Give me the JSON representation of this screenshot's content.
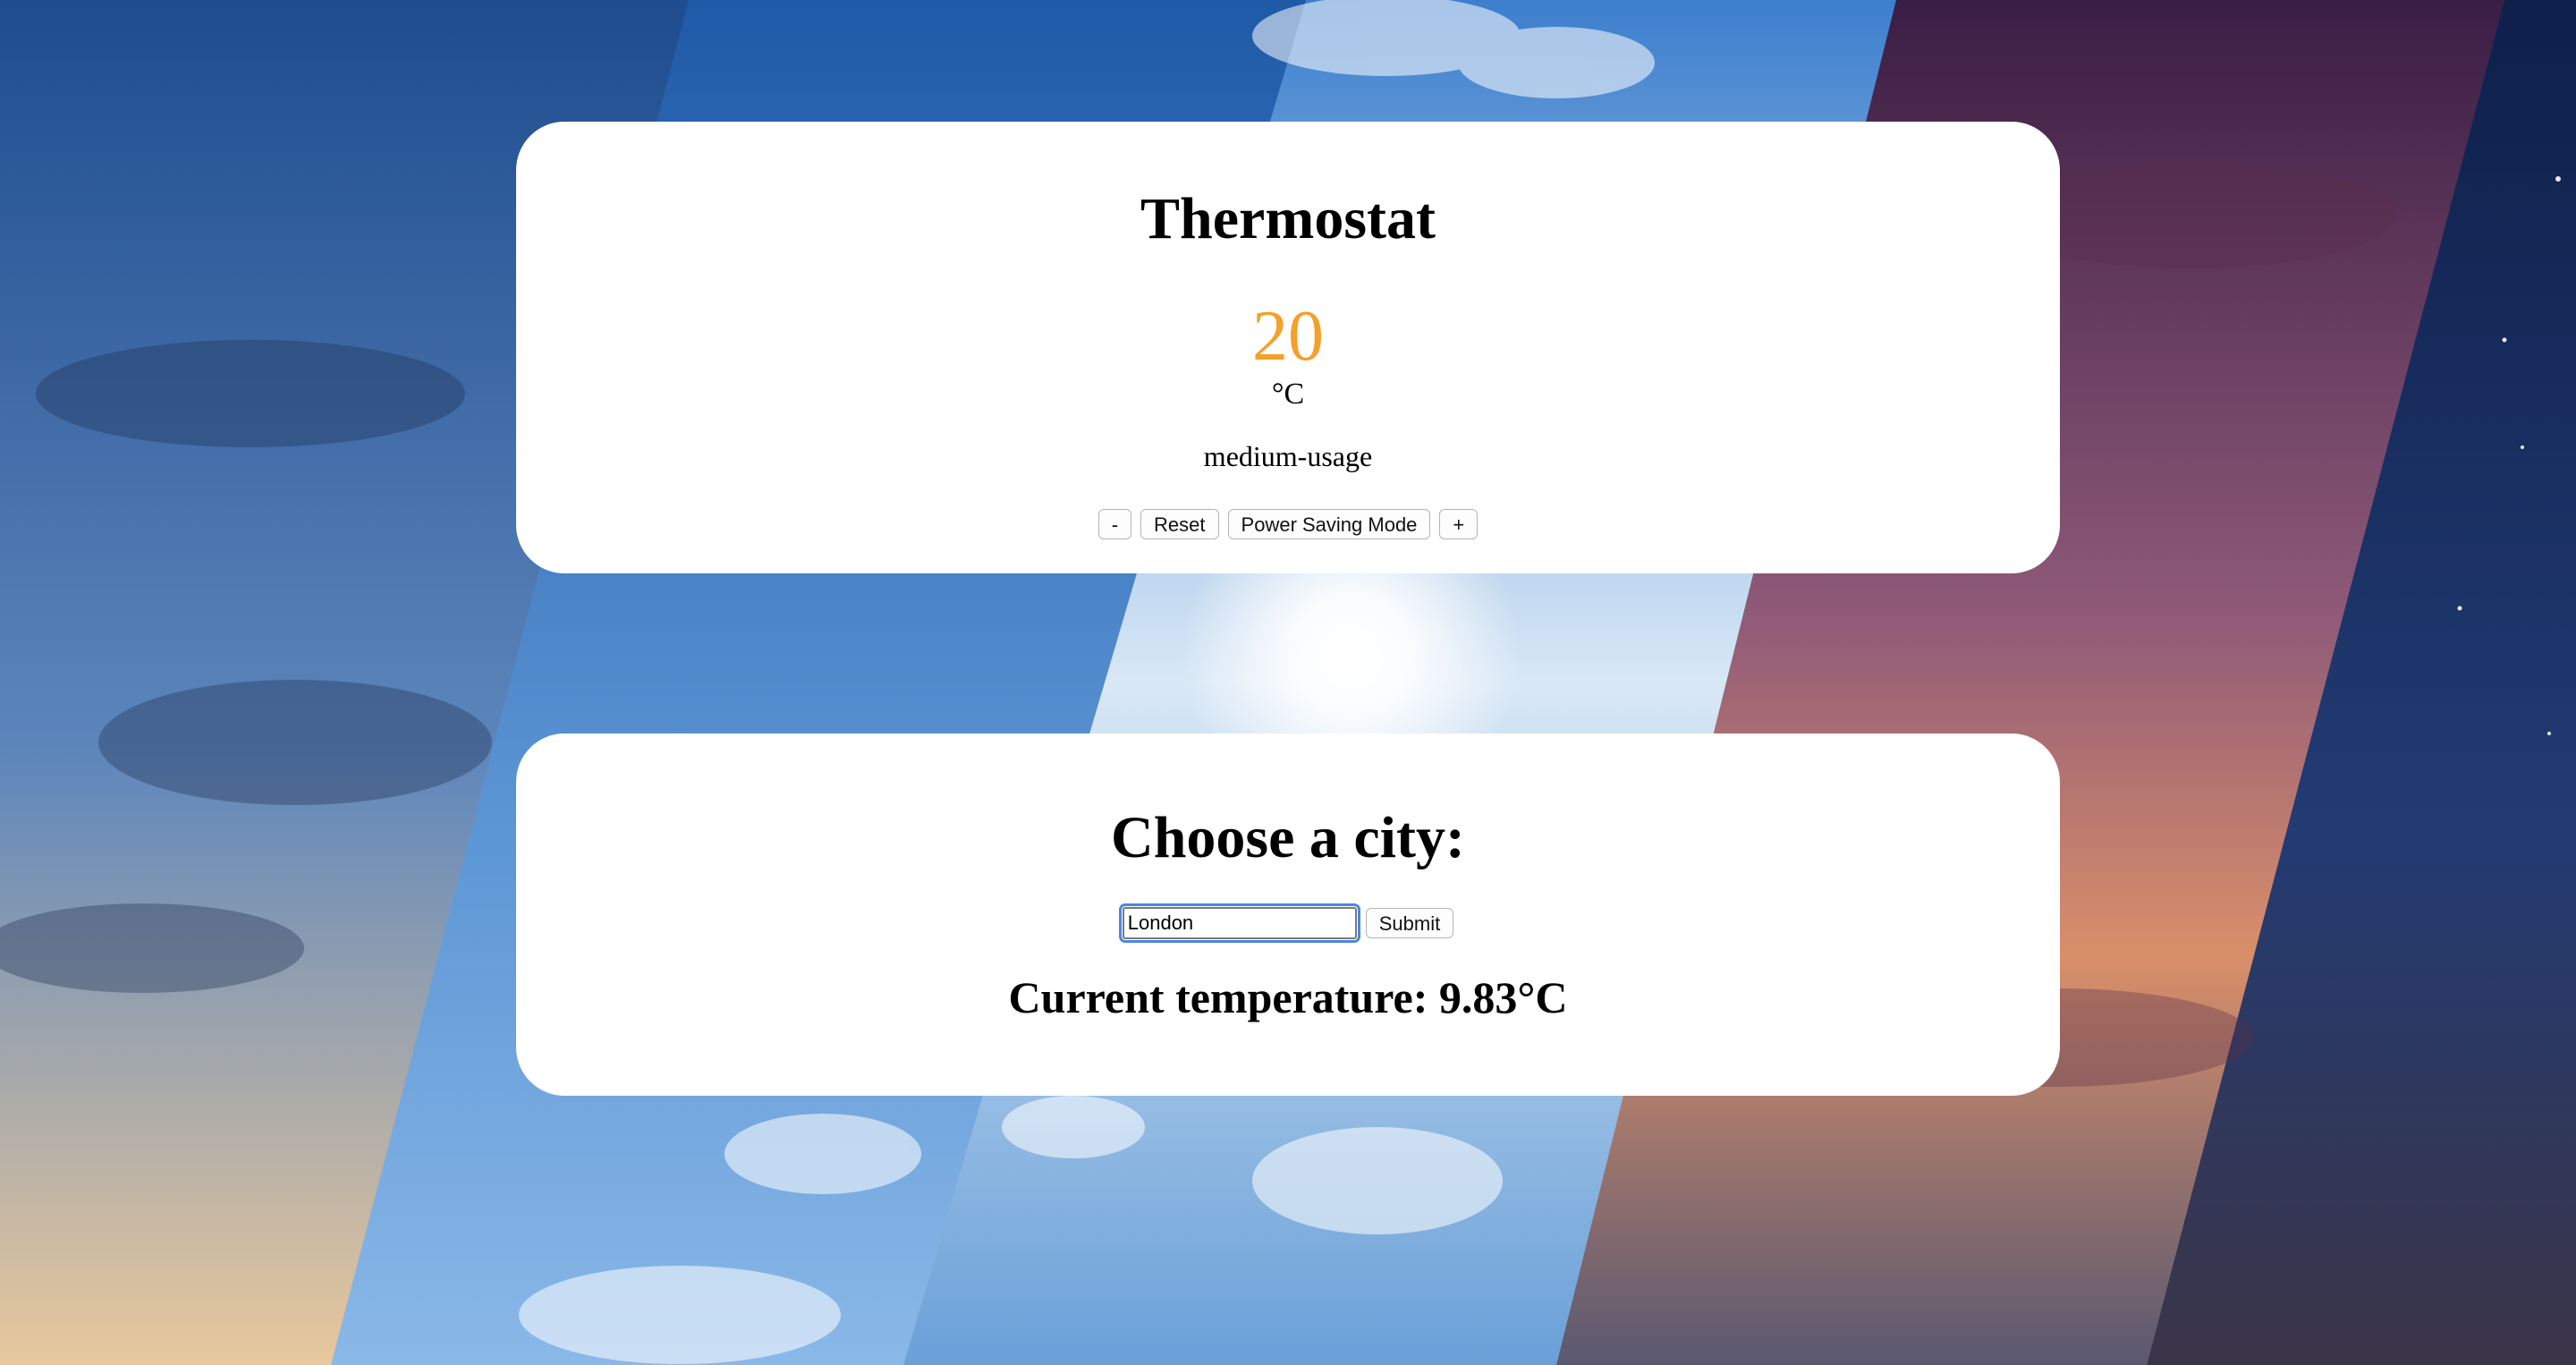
{
  "thermostat": {
    "title": "Thermostat",
    "temperature": "20",
    "unit": "°C",
    "usage": "medium-usage",
    "buttons": {
      "decrease": "-",
      "reset": "Reset",
      "power_saving": "Power Saving Mode",
      "increase": "+"
    }
  },
  "city": {
    "title": "Choose a city:",
    "input_value": "London",
    "submit_label": "Submit",
    "current_temperature": "Current temperature: 9.83°C"
  },
  "colors": {
    "temperature_accent": "#f5a02a",
    "focus_ring": "#4c86e6",
    "card_background": "#ffffff"
  },
  "background": {
    "icons": [
      "moon-icon",
      "sun-icon",
      "stars-icon"
    ]
  }
}
